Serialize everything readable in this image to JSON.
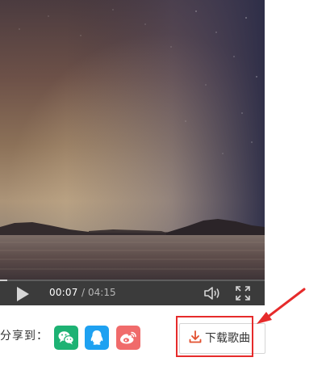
{
  "player": {
    "current_time": "00:07",
    "time_separator": "/",
    "total_time": "04:15",
    "progress_fraction": 0.027
  },
  "share": {
    "label": "分享到：",
    "targets": [
      {
        "name": "wechat",
        "icon": "wechat-icon",
        "color": "#1db273"
      },
      {
        "name": "qq",
        "icon": "qq-icon",
        "color": "#1ea1f1"
      },
      {
        "name": "weibo",
        "icon": "weibo-icon",
        "color": "#f06b6b"
      }
    ]
  },
  "download": {
    "label": "下载歌曲",
    "icon": "download-icon",
    "icon_color": "#e2502f"
  },
  "annotation": {
    "color": "#e62b2b"
  }
}
